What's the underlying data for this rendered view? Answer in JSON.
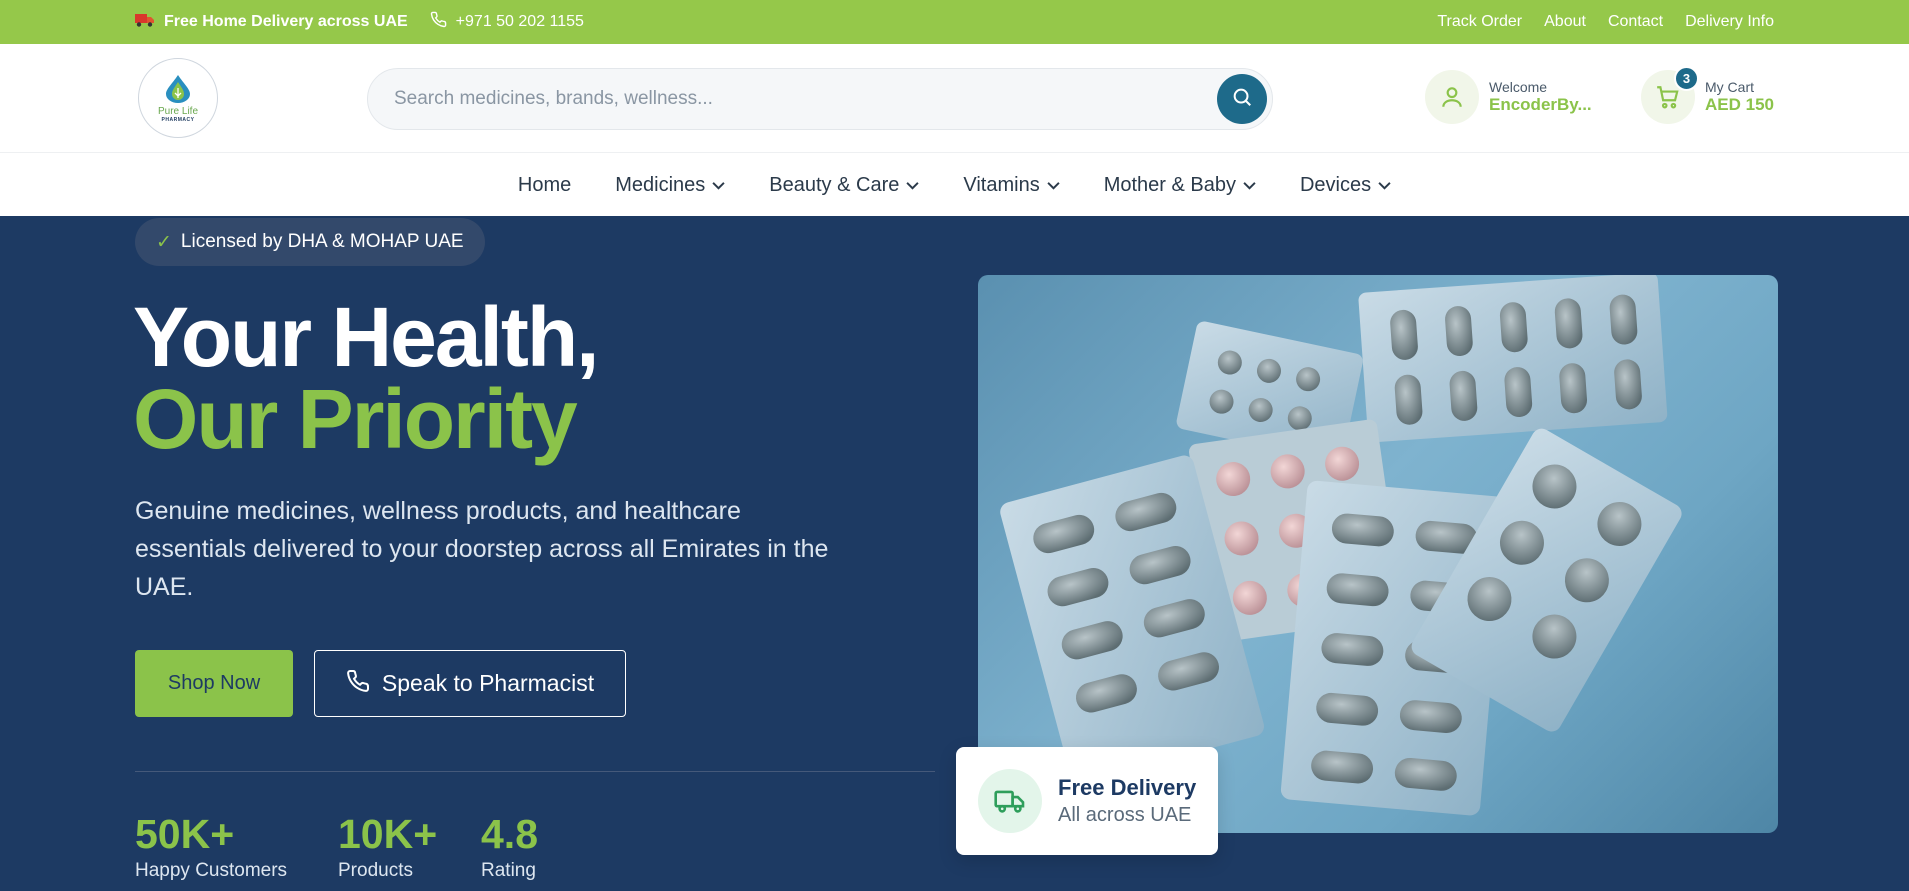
{
  "topbar": {
    "delivery_text": "Free Home Delivery across UAE",
    "phone": "+971 50 202 1155",
    "links": [
      "Track Order",
      "About",
      "Contact",
      "Delivery Info"
    ]
  },
  "header": {
    "logo": {
      "brand": "Pure Life",
      "sub": "PHARMACY"
    },
    "search_placeholder": "Search medicines, brands, wellness...",
    "account": {
      "greeting": "Welcome",
      "username": "EncoderBy..."
    },
    "cart": {
      "label": "My Cart",
      "total": "AED 150",
      "count": "3"
    }
  },
  "nav": {
    "items": [
      {
        "label": "Home",
        "dropdown": false
      },
      {
        "label": "Medicines",
        "dropdown": true
      },
      {
        "label": "Beauty & Care",
        "dropdown": true
      },
      {
        "label": "Vitamins",
        "dropdown": true
      },
      {
        "label": "Mother & Baby",
        "dropdown": true
      },
      {
        "label": "Devices",
        "dropdown": true
      }
    ]
  },
  "hero": {
    "license_badge": "Licensed by DHA & MOHAP UAE",
    "title_line1": "Your Health,",
    "title_line2": "Our Priority",
    "description": "Genuine medicines, wellness products, and healthcare essentials delivered to your doorstep across all Emirates in the UAE.",
    "shop_button": "Shop Now",
    "pharmacist_button": "Speak to Pharmacist",
    "stats": [
      {
        "value": "50K+",
        "label": "Happy Customers"
      },
      {
        "value": "10K+",
        "label": "Products"
      },
      {
        "value": "4.8",
        "label": "Rating"
      }
    ],
    "delivery_card": {
      "title": "Free Delivery",
      "subtitle": "All across UAE"
    }
  },
  "colors": {
    "accent": "#8bc34a",
    "navy": "#1d3a63",
    "teal": "#1e6a8a",
    "topbar": "#95c84a"
  },
  "icons": [
    "truck-icon",
    "phone-icon",
    "search-icon",
    "user-icon",
    "cart-icon",
    "chevron-down-icon",
    "check-icon",
    "delivery-truck-icon"
  ]
}
